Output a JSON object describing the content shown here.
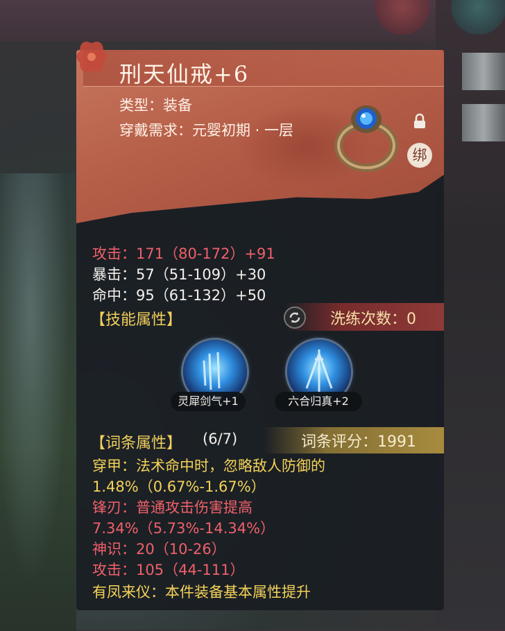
{
  "item": {
    "name": "刑天仙戒+6",
    "type_line": "类型：装备",
    "requirement_line": "穿戴需求：元婴初期 · 一层",
    "bind_label": "绑",
    "icon": "ring-icon"
  },
  "base_stats": [
    {
      "line": "攻击：171（80-172）+91",
      "color": "#f0606a"
    },
    {
      "line": "暴击：57（51-109）+30",
      "color": "#f4f1ec"
    },
    {
      "line": "命中：95（61-132）+50",
      "color": "#f4f1ec"
    }
  ],
  "skills_section": {
    "heading": "【技能属性】",
    "wash_label": "洗练次数：0",
    "skills": [
      {
        "name": "灵犀剑气+1",
        "icon": "sword-qi-skill-icon"
      },
      {
        "name": "六合归真+2",
        "icon": "swords-skill-icon"
      }
    ]
  },
  "affix_section": {
    "heading": "【词条属性】",
    "count": "(6/7)",
    "score": "词条评分：1991",
    "lines": [
      {
        "text": "穿甲：法术命中时，忽略敌人防御的",
        "color": "#f4d258"
      },
      {
        "text": "1.48%（0.67%-1.67%）",
        "color": "#f4d258"
      },
      {
        "text": "锋刃：普通攻击伤害提高",
        "color": "#f0606a"
      },
      {
        "text": "7.34%（5.73%-14.34%）",
        "color": "#f0606a"
      },
      {
        "text": "神识：20（10-26）",
        "color": "#f0606a"
      },
      {
        "text": "攻击：105（44-111）",
        "color": "#f0606a"
      },
      {
        "text": "有凤来仪：本件装备基本属性提升",
        "color": "#f4d258"
      }
    ]
  },
  "colors": {
    "header": "#b55e48",
    "panel": "#1a1e23",
    "red_stat": "#f0606a",
    "gold_text": "#f4d258"
  }
}
